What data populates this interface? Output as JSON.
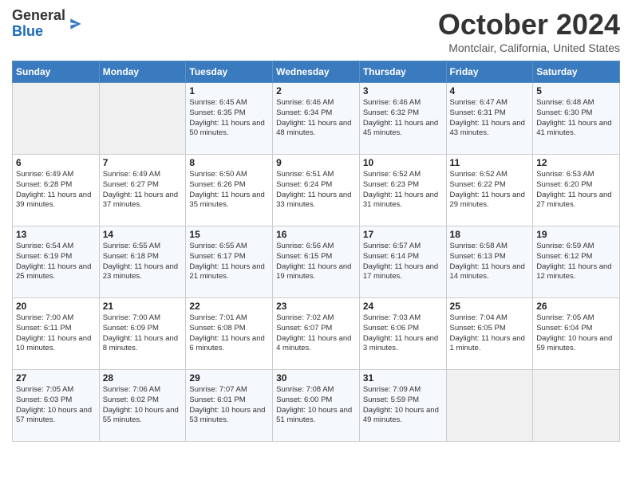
{
  "header": {
    "logo_general": "General",
    "logo_blue": "Blue",
    "title": "October 2024",
    "location": "Montclair, California, United States"
  },
  "days_of_week": [
    "Sunday",
    "Monday",
    "Tuesday",
    "Wednesday",
    "Thursday",
    "Friday",
    "Saturday"
  ],
  "weeks": [
    [
      {
        "day": "",
        "info": ""
      },
      {
        "day": "",
        "info": ""
      },
      {
        "day": "1",
        "info": "Sunrise: 6:45 AM\nSunset: 6:35 PM\nDaylight: 11 hours and 50 minutes."
      },
      {
        "day": "2",
        "info": "Sunrise: 6:46 AM\nSunset: 6:34 PM\nDaylight: 11 hours and 48 minutes."
      },
      {
        "day": "3",
        "info": "Sunrise: 6:46 AM\nSunset: 6:32 PM\nDaylight: 11 hours and 45 minutes."
      },
      {
        "day": "4",
        "info": "Sunrise: 6:47 AM\nSunset: 6:31 PM\nDaylight: 11 hours and 43 minutes."
      },
      {
        "day": "5",
        "info": "Sunrise: 6:48 AM\nSunset: 6:30 PM\nDaylight: 11 hours and 41 minutes."
      }
    ],
    [
      {
        "day": "6",
        "info": "Sunrise: 6:49 AM\nSunset: 6:28 PM\nDaylight: 11 hours and 39 minutes."
      },
      {
        "day": "7",
        "info": "Sunrise: 6:49 AM\nSunset: 6:27 PM\nDaylight: 11 hours and 37 minutes."
      },
      {
        "day": "8",
        "info": "Sunrise: 6:50 AM\nSunset: 6:26 PM\nDaylight: 11 hours and 35 minutes."
      },
      {
        "day": "9",
        "info": "Sunrise: 6:51 AM\nSunset: 6:24 PM\nDaylight: 11 hours and 33 minutes."
      },
      {
        "day": "10",
        "info": "Sunrise: 6:52 AM\nSunset: 6:23 PM\nDaylight: 11 hours and 31 minutes."
      },
      {
        "day": "11",
        "info": "Sunrise: 6:52 AM\nSunset: 6:22 PM\nDaylight: 11 hours and 29 minutes."
      },
      {
        "day": "12",
        "info": "Sunrise: 6:53 AM\nSunset: 6:20 PM\nDaylight: 11 hours and 27 minutes."
      }
    ],
    [
      {
        "day": "13",
        "info": "Sunrise: 6:54 AM\nSunset: 6:19 PM\nDaylight: 11 hours and 25 minutes."
      },
      {
        "day": "14",
        "info": "Sunrise: 6:55 AM\nSunset: 6:18 PM\nDaylight: 11 hours and 23 minutes."
      },
      {
        "day": "15",
        "info": "Sunrise: 6:55 AM\nSunset: 6:17 PM\nDaylight: 11 hours and 21 minutes."
      },
      {
        "day": "16",
        "info": "Sunrise: 6:56 AM\nSunset: 6:15 PM\nDaylight: 11 hours and 19 minutes."
      },
      {
        "day": "17",
        "info": "Sunrise: 6:57 AM\nSunset: 6:14 PM\nDaylight: 11 hours and 17 minutes."
      },
      {
        "day": "18",
        "info": "Sunrise: 6:58 AM\nSunset: 6:13 PM\nDaylight: 11 hours and 14 minutes."
      },
      {
        "day": "19",
        "info": "Sunrise: 6:59 AM\nSunset: 6:12 PM\nDaylight: 11 hours and 12 minutes."
      }
    ],
    [
      {
        "day": "20",
        "info": "Sunrise: 7:00 AM\nSunset: 6:11 PM\nDaylight: 11 hours and 10 minutes."
      },
      {
        "day": "21",
        "info": "Sunrise: 7:00 AM\nSunset: 6:09 PM\nDaylight: 11 hours and 8 minutes."
      },
      {
        "day": "22",
        "info": "Sunrise: 7:01 AM\nSunset: 6:08 PM\nDaylight: 11 hours and 6 minutes."
      },
      {
        "day": "23",
        "info": "Sunrise: 7:02 AM\nSunset: 6:07 PM\nDaylight: 11 hours and 4 minutes."
      },
      {
        "day": "24",
        "info": "Sunrise: 7:03 AM\nSunset: 6:06 PM\nDaylight: 11 hours and 3 minutes."
      },
      {
        "day": "25",
        "info": "Sunrise: 7:04 AM\nSunset: 6:05 PM\nDaylight: 11 hours and 1 minute."
      },
      {
        "day": "26",
        "info": "Sunrise: 7:05 AM\nSunset: 6:04 PM\nDaylight: 10 hours and 59 minutes."
      }
    ],
    [
      {
        "day": "27",
        "info": "Sunrise: 7:05 AM\nSunset: 6:03 PM\nDaylight: 10 hours and 57 minutes."
      },
      {
        "day": "28",
        "info": "Sunrise: 7:06 AM\nSunset: 6:02 PM\nDaylight: 10 hours and 55 minutes."
      },
      {
        "day": "29",
        "info": "Sunrise: 7:07 AM\nSunset: 6:01 PM\nDaylight: 10 hours and 53 minutes."
      },
      {
        "day": "30",
        "info": "Sunrise: 7:08 AM\nSunset: 6:00 PM\nDaylight: 10 hours and 51 minutes."
      },
      {
        "day": "31",
        "info": "Sunrise: 7:09 AM\nSunset: 5:59 PM\nDaylight: 10 hours and 49 minutes."
      },
      {
        "day": "",
        "info": ""
      },
      {
        "day": "",
        "info": ""
      }
    ]
  ]
}
